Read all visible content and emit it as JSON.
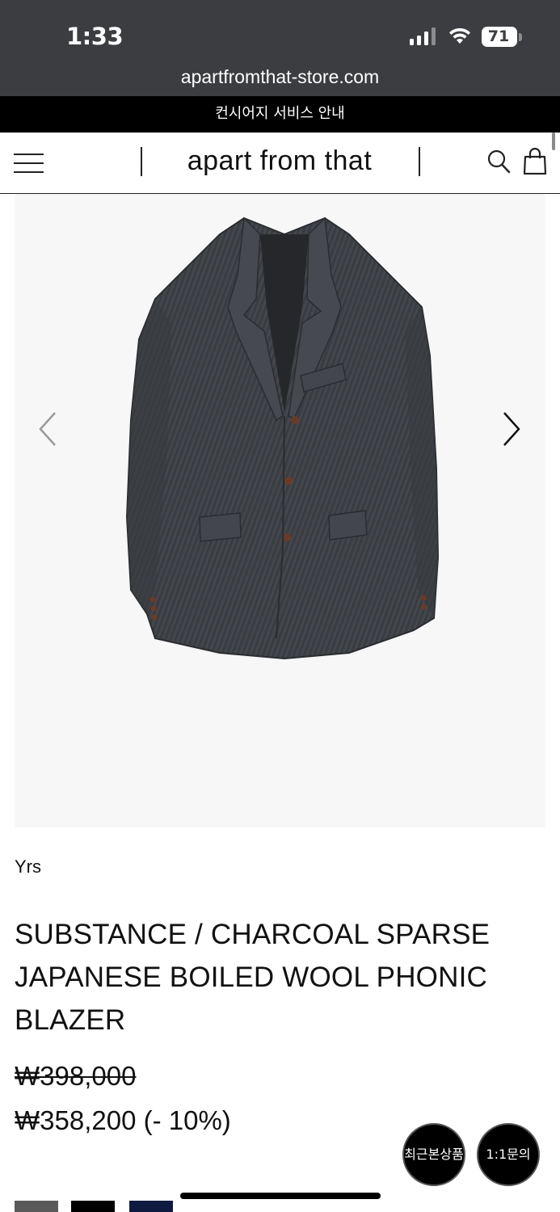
{
  "status_bar": {
    "time": "1:33",
    "battery": "71",
    "url": "apartfromthat-store.com"
  },
  "banner": {
    "text": "컨시어지 서비스 안내"
  },
  "header": {
    "logo": "apart from that",
    "icons": [
      "menu-icon",
      "search-icon",
      "bag-icon"
    ]
  },
  "gallery": {
    "image": "charcoal-blazer-photo",
    "prev_icon": "chevron-left-icon",
    "next_icon": "chevron-right-icon"
  },
  "product": {
    "brand": "Yrs",
    "title": "SUBSTANCE / CHARCOAL SPARSE JAPANESE BOILED WOOL PHONIC BLAZER",
    "price_original": "₩398,000",
    "price_sale": "₩358,200 (- 10%)"
  },
  "floating": {
    "recent_label": "최근본상품",
    "inquiry_label": "1:1문의"
  },
  "swatches": {
    "colors": [
      "#5a5a5a",
      "#000000",
      "#0f1a40"
    ]
  },
  "colors": {
    "status_bg": "#3b3d40",
    "banner_bg": "#000000",
    "gallery_bg": "#f7f7f7"
  }
}
